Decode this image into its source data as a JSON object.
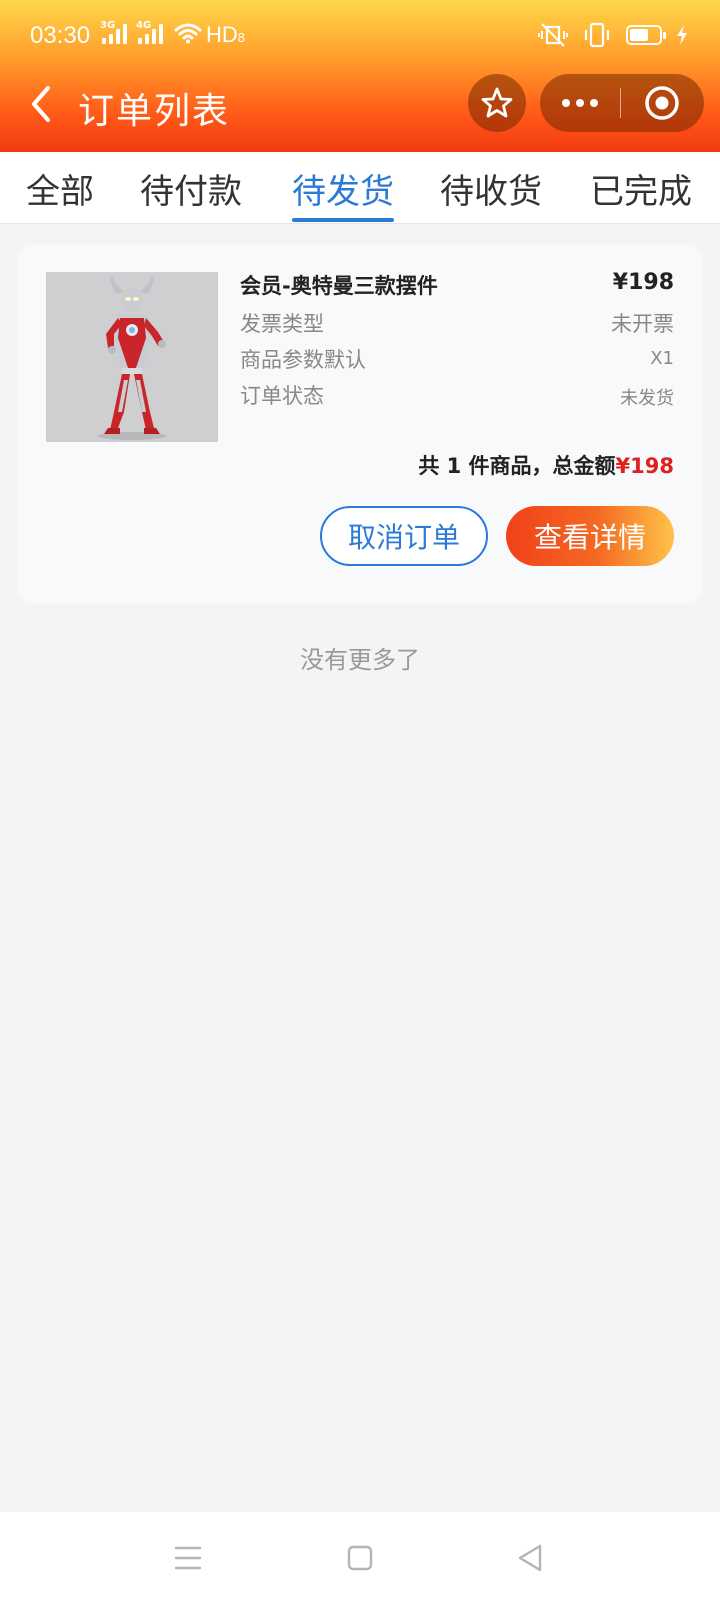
{
  "status_bar": {
    "time": "03:30",
    "network1": "3G",
    "network2": "4G",
    "hd": "HD",
    "hd_sub": "8",
    "battery_level": 0.65
  },
  "header": {
    "title": "订单列表"
  },
  "tabs": [
    {
      "label": "全部"
    },
    {
      "label": "待付款"
    },
    {
      "label": "待发货"
    },
    {
      "label": "待收货"
    },
    {
      "label": "已完成"
    }
  ],
  "active_tab": "待发货",
  "order": {
    "product_name": "会员-奥特曼三款摆件",
    "price": "¥198",
    "rows": [
      {
        "label": "发票类型",
        "value": "未开票"
      },
      {
        "label": "商品参数默认",
        "value": "X1"
      },
      {
        "label": "订单状态",
        "value": "未发货"
      }
    ],
    "total_prefix": "共 1 件商品，总金额",
    "total_amount": "¥198",
    "cancel_label": "取消订单",
    "detail_label": "查看详情"
  },
  "list_footer": "没有更多了",
  "colors": {
    "accent_blue": "#2b7bd6",
    "price_red": "#e02020",
    "header_orange": "#ff5a18"
  },
  "icons": {
    "back": "chevron-left-icon",
    "favorite": "star-icon",
    "more": "more-dots-icon",
    "close": "target-circle-icon",
    "nav_menu": "menu-lines-icon",
    "nav_home": "square-icon",
    "nav_back": "triangle-back-icon"
  }
}
